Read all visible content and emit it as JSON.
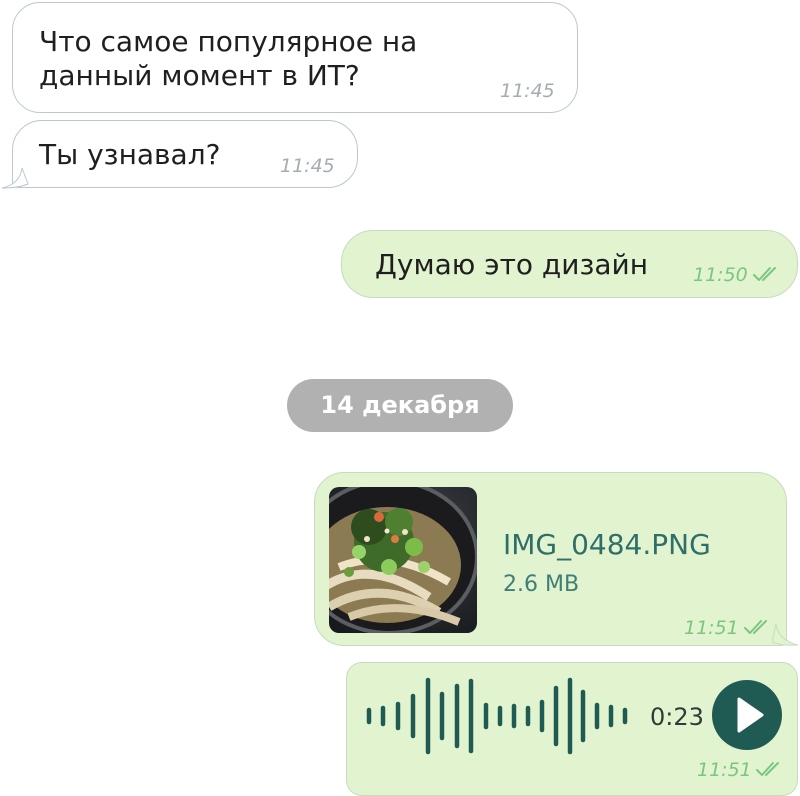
{
  "messages": [
    {
      "direction": "incoming",
      "text": "Что самое популярное на данный момент в ИТ?",
      "time": "11:45"
    },
    {
      "direction": "incoming",
      "text": "Ты узнавал?",
      "time": "11:45"
    },
    {
      "direction": "outgoing",
      "text": "Думаю это дизайн",
      "time": "11:50",
      "status": "read"
    }
  ],
  "date_separator": "14 декабря",
  "file_message": {
    "file_name": "IMG_0484.PNG",
    "file_size": "2.6 MB",
    "time": "11:51",
    "status": "read",
    "thumbnail_icon": "noodle-soup-photo"
  },
  "voice_message": {
    "duration": "0:23",
    "time": "11:51",
    "status": "read",
    "play_icon": "play-icon"
  },
  "colors": {
    "incoming_bg": "#ffffff",
    "outgoing_bg": "#e2f4cf",
    "accent": "#1f5b53",
    "time_outgoing": "#7bc67f",
    "time_incoming": "#a5adb3",
    "date_pill": "#b1b1b1"
  }
}
